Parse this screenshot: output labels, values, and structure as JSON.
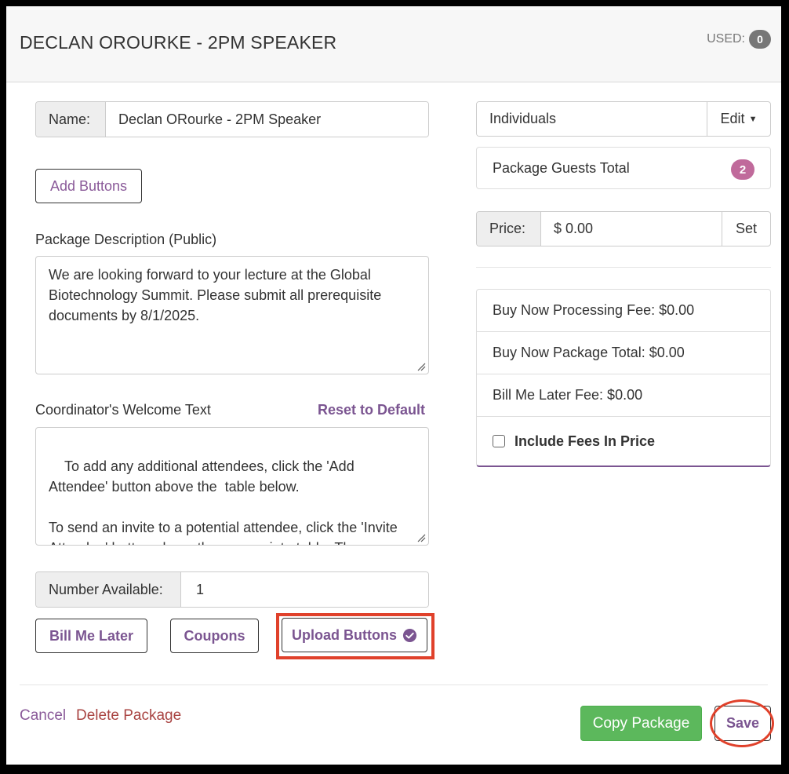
{
  "header": {
    "title": "DECLAN OROURKE - 2PM SPEAKER",
    "used_label": "USED:",
    "used_count": "0"
  },
  "form": {
    "name_label": "Name:",
    "name_value": "Declan ORourke - 2PM Speaker",
    "add_buttons_label": "Add Buttons",
    "description_label": "Package Description (Public)",
    "description_text": "We are looking forward to your lecture at the Global Biotechnology Summit. Please submit all prerequisite documents by 8/1/2025.",
    "welcome_label": "Coordinator's Welcome Text",
    "reset_default_label": "Reset to Default",
    "welcome_text": "To add any additional attendees, click the 'Add Attendee' button above the  table below.\n\nTo send an invite to a potential attendee, click the 'Invite Attendee' button above the appropriate table. The individual will receive an invite email from",
    "number_available_label": "Number Available:",
    "number_available_value": "1",
    "bill_me_later_label": "Bill Me Later",
    "coupons_label": "Coupons",
    "upload_buttons_label": "Upload Buttons"
  },
  "sidebar": {
    "type_value": "Individuals",
    "edit_label": "Edit",
    "guests_total_label": "Package Guests Total",
    "guests_total_count": "2",
    "price_label": "Price:",
    "price_value": "$ 0.00",
    "set_label": "Set",
    "fees": {
      "processing_fee": "Buy Now Processing Fee: $0.00",
      "package_total": "Buy Now Package Total: $0.00",
      "bill_later_fee": "Bill Me Later Fee: $0.00",
      "include_fees_label": "Include Fees In Price"
    }
  },
  "footer": {
    "cancel_label": "Cancel",
    "delete_label": "Delete Package",
    "copy_label": "Copy Package",
    "save_label": "Save"
  },
  "colors": {
    "accent_purple": "#7b5591",
    "badge_pink": "#c06a9b",
    "delete_red": "#a94442",
    "copy_green": "#5cb85c",
    "highlight_red": "#e0412b"
  }
}
